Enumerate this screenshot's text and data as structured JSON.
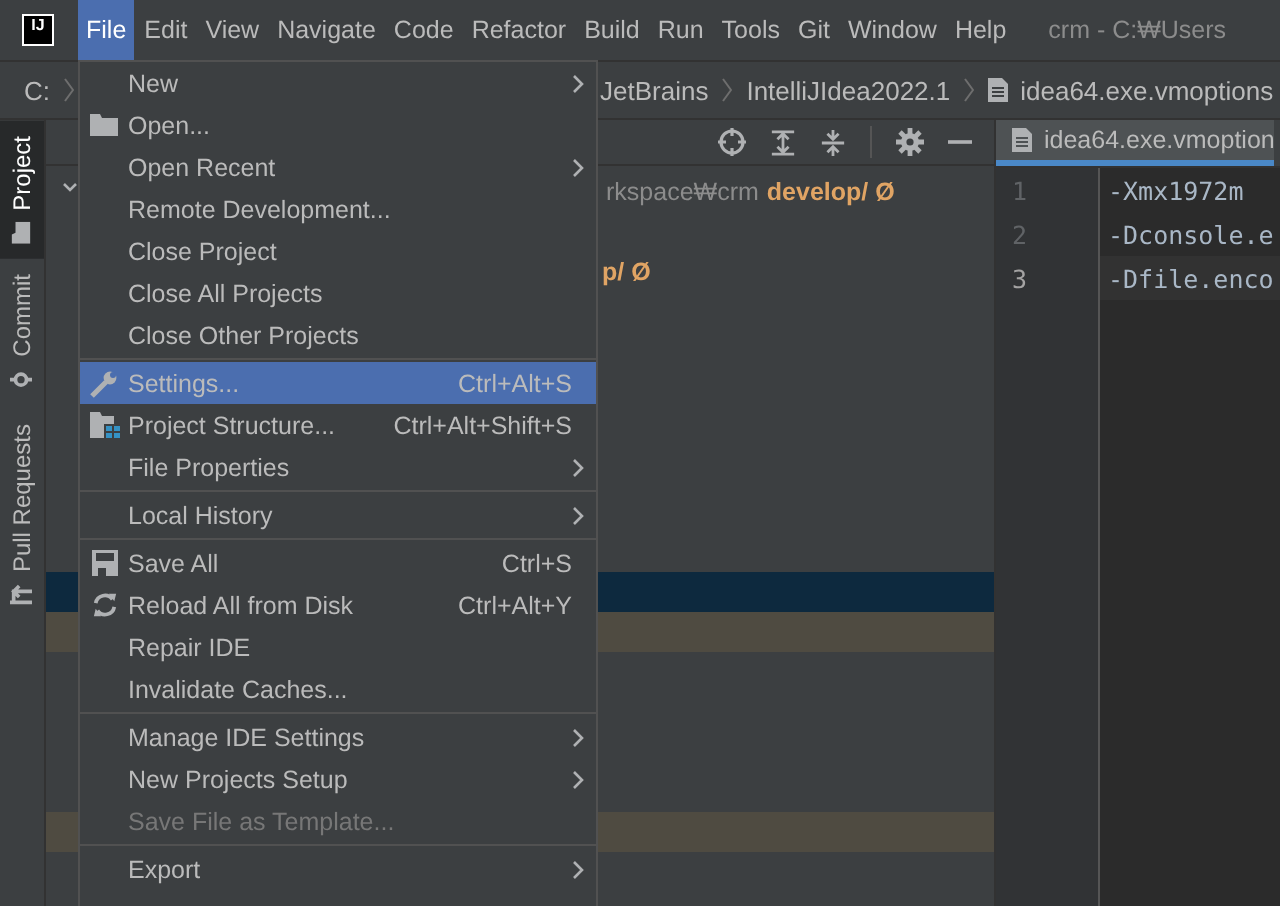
{
  "menubar": {
    "logo": "IJ",
    "menus": [
      {
        "label": "File",
        "selected": true
      },
      {
        "label": "Edit",
        "selected": false
      },
      {
        "label": "View",
        "selected": false
      },
      {
        "label": "Navigate",
        "selected": false
      },
      {
        "label": "Code",
        "selected": false
      },
      {
        "label": "Refactor",
        "selected": false
      },
      {
        "label": "Build",
        "selected": false
      },
      {
        "label": "Run",
        "selected": false
      },
      {
        "label": "Tools",
        "selected": false
      },
      {
        "label": "Git",
        "selected": false
      },
      {
        "label": "Window",
        "selected": false
      },
      {
        "label": "Help",
        "selected": false
      }
    ],
    "title": "crm - C:₩Users"
  },
  "breadcrumb": {
    "drive": "C:",
    "items": [
      "JetBrains",
      "IntelliJIdea2022.1",
      "idea64.exe.vmoptions"
    ]
  },
  "tool_window_tabs": [
    {
      "label": "Project",
      "kind": "project",
      "selected": true
    },
    {
      "label": "Commit",
      "kind": "commit",
      "selected": false
    },
    {
      "label": "Pull Requests",
      "kind": "pull",
      "selected": false
    }
  ],
  "project_tree": {
    "rows": [
      {
        "dim": "rkspace₩crm",
        "branch": "develop/ Ø",
        "expandable": true,
        "selected": false,
        "highlighted": false
      },
      {
        "selected": false,
        "highlighted": false
      },
      {
        "branch": "p/ Ø",
        "selected": false,
        "highlighted": false
      },
      {
        "selected": false,
        "highlighted": false
      },
      {
        "selected": false,
        "highlighted": false
      },
      {
        "selected": false,
        "highlighted": false
      },
      {
        "selected": false,
        "highlighted": false
      },
      {
        "selected": false,
        "highlighted": false
      },
      {
        "selected": false,
        "highlighted": false
      },
      {
        "selected": false,
        "highlighted": false
      },
      {
        "selected": true,
        "highlighted": false
      },
      {
        "selected": false,
        "highlighted": true
      },
      {
        "selected": false,
        "highlighted": false
      },
      {
        "selected": false,
        "highlighted": false
      },
      {
        "selected": false,
        "highlighted": false
      },
      {
        "selected": false,
        "highlighted": false
      },
      {
        "selected": false,
        "highlighted": true
      },
      {
        "selected": false,
        "highlighted": false
      }
    ]
  },
  "editor": {
    "tab": {
      "label": "idea64.exe.vmoption",
      "selected": true
    },
    "lines": [
      {
        "number": "1",
        "code": "-Xmx1972m",
        "current": false
      },
      {
        "number": "2",
        "code": "-Dconsole.e",
        "current": false
      },
      {
        "number": "3",
        "code": "-Dfile.enco",
        "current": true
      }
    ]
  },
  "file_menu": {
    "items": [
      {
        "kind": "item",
        "label": "New",
        "submenu": true,
        "disabled": false,
        "selected": false
      },
      {
        "kind": "item",
        "label": "Open...",
        "disabled": false,
        "selected": false
      },
      {
        "kind": "item",
        "label": "Open Recent",
        "submenu": true,
        "disabled": false,
        "selected": false
      },
      {
        "kind": "item",
        "label": "Remote Development...",
        "disabled": false,
        "selected": false
      },
      {
        "kind": "item",
        "label": "Close Project",
        "disabled": false,
        "selected": false
      },
      {
        "kind": "item",
        "label": "Close All Projects",
        "disabled": false,
        "selected": false
      },
      {
        "kind": "item",
        "label": "Close Other Projects",
        "disabled": false,
        "selected": false
      },
      {
        "kind": "separator"
      },
      {
        "kind": "item",
        "label": "Settings...",
        "shortcut": "Ctrl+Alt+S",
        "disabled": false,
        "selected": true
      },
      {
        "kind": "item",
        "label": "Project Structure...",
        "shortcut": "Ctrl+Alt+Shift+S",
        "disabled": false,
        "selected": false
      },
      {
        "kind": "item",
        "label": "File Properties",
        "submenu": true,
        "disabled": false,
        "selected": false
      },
      {
        "kind": "separator"
      },
      {
        "kind": "item",
        "label": "Local History",
        "submenu": true,
        "disabled": false,
        "selected": false
      },
      {
        "kind": "separator"
      },
      {
        "kind": "item",
        "label": "Save All",
        "shortcut": "Ctrl+S",
        "disabled": false,
        "selected": false
      },
      {
        "kind": "item",
        "label": "Reload All from Disk",
        "shortcut": "Ctrl+Alt+Y",
        "disabled": false,
        "selected": false
      },
      {
        "kind": "item",
        "label": "Repair IDE",
        "disabled": false,
        "selected": false
      },
      {
        "kind": "item",
        "label": "Invalidate Caches...",
        "disabled": false,
        "selected": false
      },
      {
        "kind": "separator"
      },
      {
        "kind": "item",
        "label": "Manage IDE Settings",
        "submenu": true,
        "disabled": false,
        "selected": false
      },
      {
        "kind": "item",
        "label": "New Projects Setup",
        "submenu": true,
        "disabled": false,
        "selected": false
      },
      {
        "kind": "item",
        "label": "Save File as Template...",
        "disabled": true,
        "selected": false
      },
      {
        "kind": "separator"
      },
      {
        "kind": "item",
        "label": "Export",
        "submenu": true,
        "disabled": false,
        "selected": false
      }
    ]
  }
}
